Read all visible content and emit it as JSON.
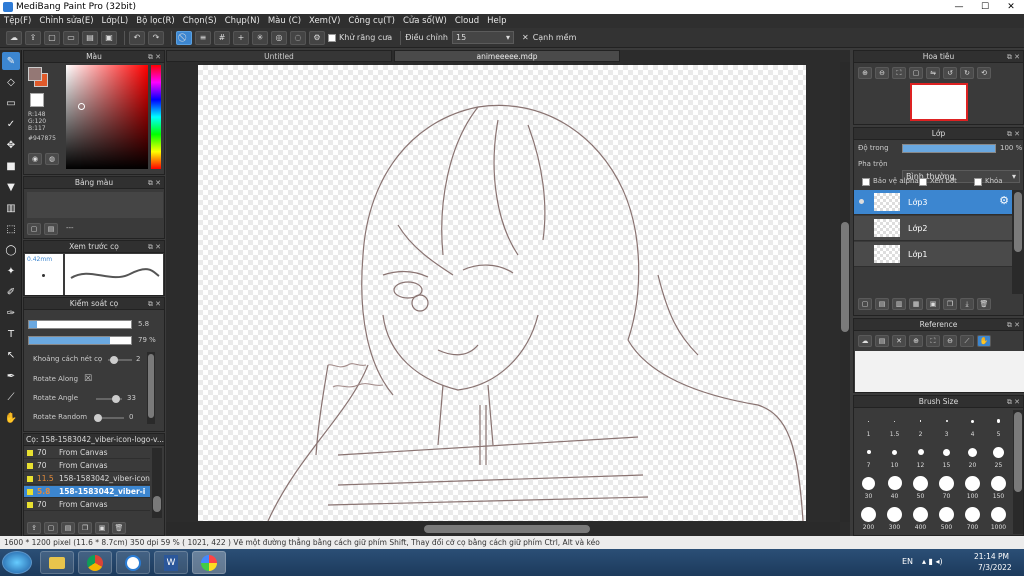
{
  "window": {
    "title": "MediBang Paint Pro (32bit)",
    "minimize": "—",
    "maximize": "☐",
    "close": "✕"
  },
  "menu": [
    "Tệp(F)",
    "Chỉnh sửa(E)",
    "Lớp(L)",
    "Bộ lọc(R)",
    "Chọn(S)",
    "Chụp(N)",
    "Màu (C)",
    "Xem(V)",
    "Công cụ(T)",
    "Cửa sổ(W)",
    "Cloud",
    "Help"
  ],
  "toolbar": {
    "antialias_label": "Khử răng cưa",
    "correction_label": "Điều chỉnh",
    "correction_value": "15",
    "edge_label": "Cạnh mềm",
    "edge_mark": "✕"
  },
  "color_panel": {
    "title": "Màu",
    "rgb": "R:148\nG:120\nB:117",
    "hex": "#947875",
    "primary": "#947875",
    "secondary": "#e05a2a"
  },
  "palette_panel": {
    "title": "Bảng màu",
    "value": "---"
  },
  "brush_preview": {
    "title": "Xem trước cọ",
    "size": "0.42mm"
  },
  "brush_control": {
    "title": "Kiểm soát cọ",
    "size": "5.8",
    "opacity": "79 %",
    "opacity_level": 0.79,
    "props": [
      {
        "label": "Khoảng cách nét cọ",
        "value": "2",
        "level": 0.15
      },
      {
        "label": "Rotate Along",
        "value": "☒"
      },
      {
        "label": "Rotate Angle",
        "value": "33",
        "level": 0.9
      },
      {
        "label": "Rotate Random",
        "value": "0",
        "level": 0.0
      }
    ]
  },
  "brush_list": {
    "title": "Cọ: 158-1583042_viber-icon-logo-v...",
    "rows": [
      {
        "n": "70",
        "name": "From Canvas",
        "color": "#e8e030"
      },
      {
        "n": "70",
        "name": "From Canvas",
        "color": "#e8e030"
      },
      {
        "n": "11.5",
        "name": "158-1583042_viber-icon-l",
        "color": "#e8e030"
      },
      {
        "n": "5.8",
        "name": "158-1583042_viber-i",
        "color": "#e8e030"
      },
      {
        "n": "70",
        "name": "From Canvas",
        "color": "#e8e030"
      }
    ]
  },
  "tabs": [
    {
      "label": "Untitled"
    },
    {
      "label": "animeeeee.mdp"
    }
  ],
  "navigator": {
    "title": "Hoa tiêu"
  },
  "layer_panel": {
    "title": "Lớp",
    "opacity_label": "Độ trong",
    "opacity": "100 %",
    "opacity_level": 1.0,
    "blend_label": "Pha trộn",
    "blend_value": "Bình thường",
    "protect_alpha": "Bảo vệ alpha",
    "clip": "Xén bớt",
    "lock": "Khóa",
    "layers": [
      {
        "name": "Lớp3"
      },
      {
        "name": "Lớp2"
      },
      {
        "name": "Lớp1"
      }
    ]
  },
  "reference_panel": {
    "title": "Reference"
  },
  "brush_size_panel": {
    "title": "Brush Size",
    "sizes": [
      "1",
      "1.5",
      "2",
      "3",
      "4",
      "5",
      "7",
      "10",
      "12",
      "15",
      "20",
      "25",
      "30",
      "40",
      "50",
      "70",
      "100",
      "150",
      "200",
      "300",
      "400",
      "500",
      "700",
      "1000"
    ]
  },
  "status": {
    "text": "1600 * 1200 pixel  (11.6 * 8.7cm)  350 dpi  59 %  ( 1021, 422 )  Vẽ một đường thẳng bằng cách giữ phím Shift, Thay đổi cỡ cọ bằng cách giữ phím Ctrl, Alt và kéo"
  },
  "taskbar": {
    "lang": "EN",
    "time": "21:14 PM",
    "date": "7/3/2022"
  }
}
